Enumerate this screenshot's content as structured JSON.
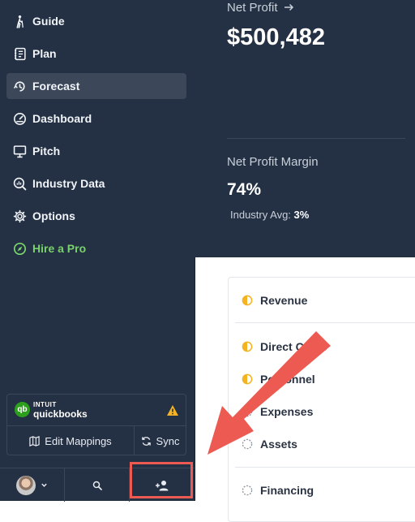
{
  "sidebar": {
    "items": [
      {
        "label": "Guide",
        "icon": "hiker-icon"
      },
      {
        "label": "Plan",
        "icon": "notebook-icon"
      },
      {
        "label": "Forecast",
        "icon": "forecast-icon",
        "active": true
      },
      {
        "label": "Dashboard",
        "icon": "gauge-icon"
      },
      {
        "label": "Pitch",
        "icon": "monitor-icon"
      },
      {
        "label": "Industry Data",
        "icon": "industry-data-icon"
      },
      {
        "label": "Options",
        "icon": "gear-icon"
      },
      {
        "label": "Hire a Pro",
        "icon": "compass-icon"
      }
    ],
    "quickbooks": {
      "intuit": "INTUIT",
      "name": "quickbooks",
      "edit_label": "Edit Mappings",
      "sync_label": "Sync"
    }
  },
  "summary": {
    "net_profit_label": "Net Profit",
    "net_profit_value": "$500,482",
    "margin_label": "Net Profit Margin",
    "margin_value": "74%",
    "industry_avg_label": "Industry Avg:",
    "industry_avg_value": "3%"
  },
  "forecast_items": [
    {
      "label": "Revenue",
      "status": "partial"
    },
    {
      "label": "Direct Costs",
      "status": "partial"
    },
    {
      "label": "Personnel",
      "status": "partial"
    },
    {
      "label": "Expenses",
      "status": "empty"
    },
    {
      "label": "Assets",
      "status": "empty"
    },
    {
      "label": "Financing",
      "status": "empty"
    }
  ],
  "colors": {
    "sidebar_bg": "#243043",
    "active_bg": "#3c4859",
    "hire_green": "#79d26b",
    "status_yellow": "#f5b324",
    "annotation_red": "#ec5a52",
    "quickbooks_green": "#2ca01c"
  }
}
